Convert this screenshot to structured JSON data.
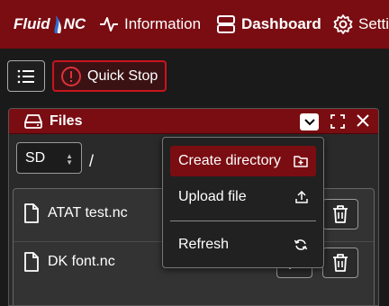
{
  "navbar": {
    "brand_left": "Fluid",
    "brand_right": "NC",
    "items": [
      {
        "label": "Information",
        "icon": "activity-icon"
      },
      {
        "label": "Dashboard",
        "icon": "dashboard-icon"
      },
      {
        "label": "Setti",
        "icon": "gear-icon"
      }
    ]
  },
  "toolbar": {
    "menu_icon": "list-icon",
    "quick_stop_label": "Quick Stop",
    "quick_stop_color": "#c8151e"
  },
  "files_panel": {
    "title": "Files",
    "drive_select": "SD",
    "current_path": "/",
    "files": [
      {
        "name": "ATAT test.nc"
      },
      {
        "name": "DK font.nc"
      }
    ]
  },
  "dropdown": {
    "items": [
      {
        "label": "Create directory",
        "icon": "folder-plus-icon",
        "active": true
      },
      {
        "label": "Upload file",
        "icon": "upload-icon",
        "active": false
      },
      {
        "label": "Refresh",
        "icon": "refresh-icon",
        "active": false
      }
    ]
  },
  "colors": {
    "accent": "#7a0d12",
    "background": "#1a1a1a"
  }
}
